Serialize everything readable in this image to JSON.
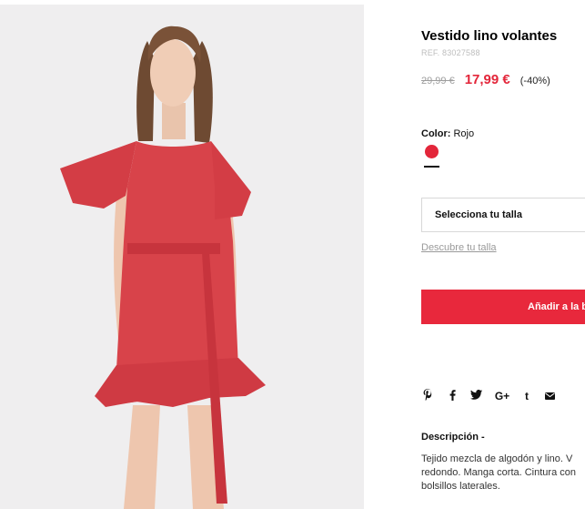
{
  "product": {
    "title": "Vestido lino volantes",
    "ref": "REF. 83027588",
    "price_old": "29,99 €",
    "price_new": "17,99 €",
    "discount": "(-40%)"
  },
  "color": {
    "label": "Color:",
    "value": "Rojo",
    "swatch_hex": "#e3263a"
  },
  "size": {
    "select_label": "Selecciona tu talla",
    "guide_link": "Descubre tu talla"
  },
  "cart": {
    "add_label": "Añadir a la b"
  },
  "share": {
    "icons": [
      "pinterest-icon",
      "facebook-icon",
      "twitter-icon",
      "google-plus-icon",
      "tumblr-icon",
      "email-icon"
    ]
  },
  "description": {
    "title": "Descripción -",
    "lines": [
      "Tejido mezcla de algodón y lino. V",
      "redondo. Manga corta. Cintura con",
      "bolsillos laterales."
    ]
  },
  "colors": {
    "accent": "#e8283c",
    "dress": "#d8434a"
  }
}
